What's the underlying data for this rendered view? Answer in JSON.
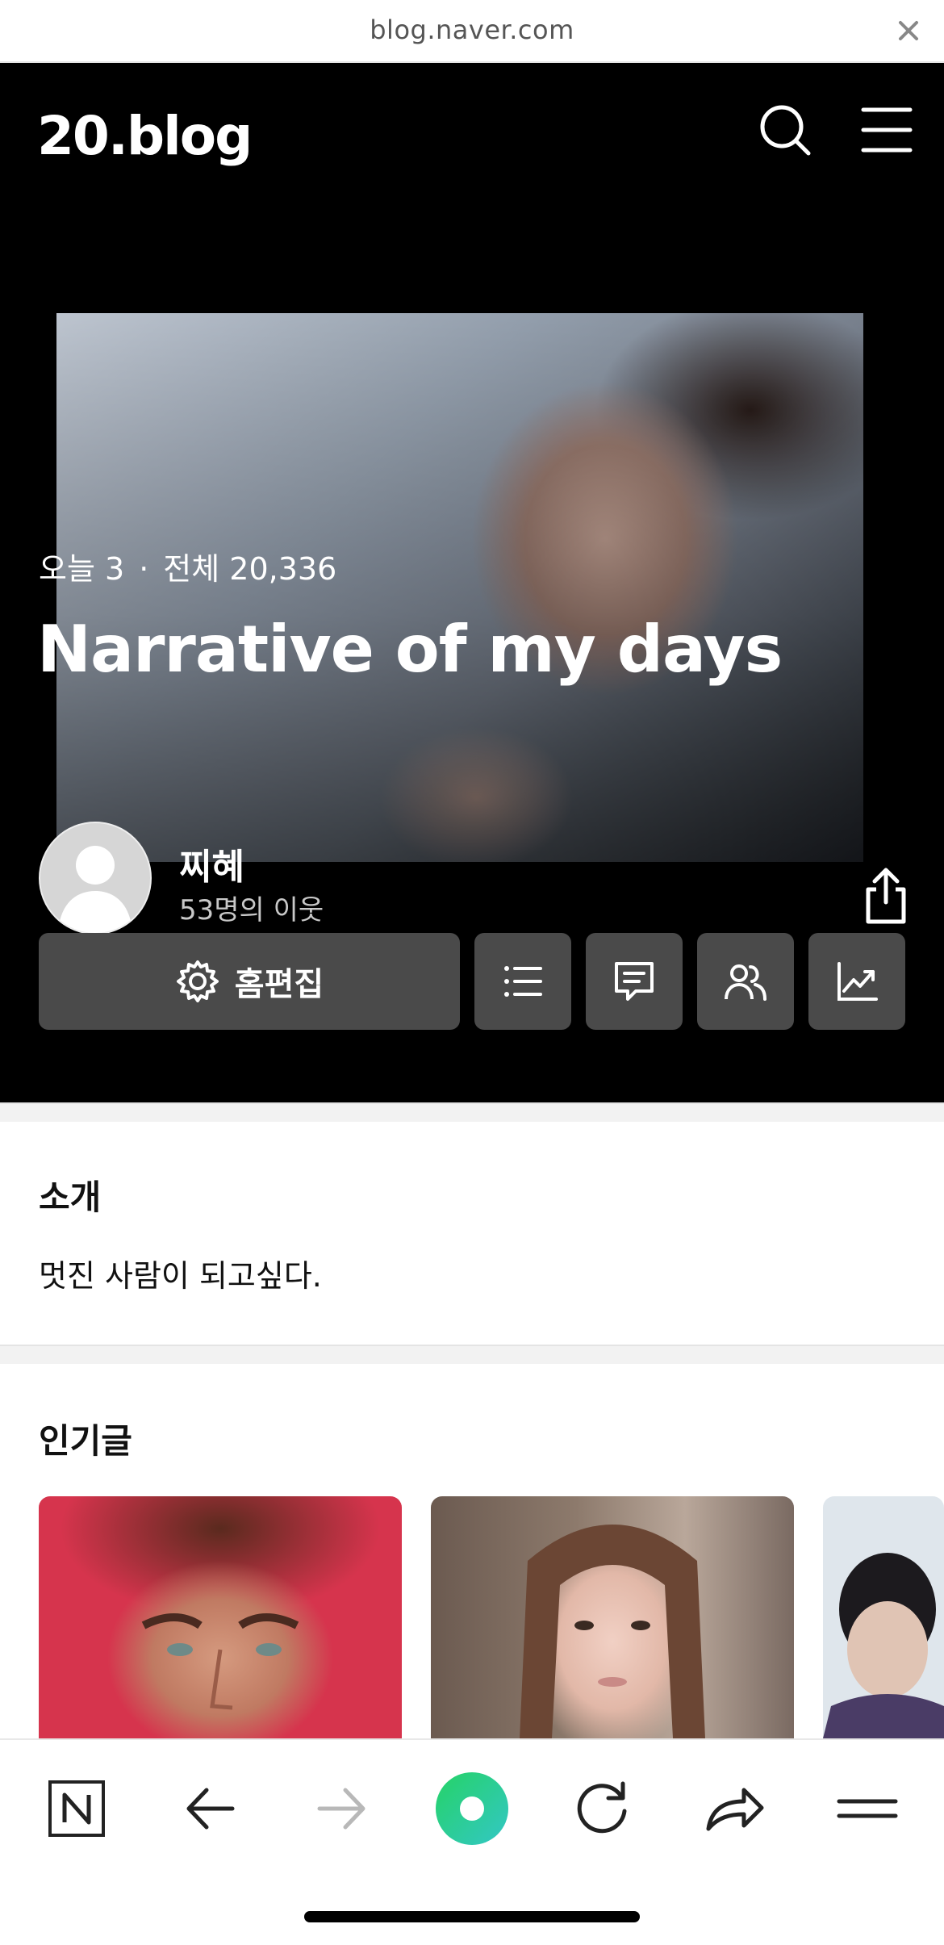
{
  "browser": {
    "url": "blog.naver.com",
    "close_icon": "close-icon"
  },
  "header": {
    "logo": "20.blog",
    "icons": [
      "search-icon",
      "menu-icon"
    ]
  },
  "profile": {
    "today_label": "오늘 3",
    "separator": "·",
    "total_label": "전체 20,336",
    "blog_title": "Narrative of my days",
    "user_name": "찌혜",
    "neighbors": "53명의 이웃",
    "share_icon": "share-icon"
  },
  "actions": {
    "edit_label": "홈편집",
    "icons": [
      "gear-icon",
      "list-icon",
      "comment-icon",
      "people-icon",
      "stats-chart-icon"
    ]
  },
  "intro": {
    "title": "소개",
    "text": "멋진 사람이 되고싶다."
  },
  "popular": {
    "title": "인기글",
    "cards": [
      "card-1",
      "card-2",
      "card-3"
    ]
  },
  "bottom_nav": {
    "icons": [
      "naver-n-icon",
      "back-arrow-icon",
      "forward-arrow-icon",
      "green-dot-icon",
      "refresh-icon",
      "share-arrow-icon",
      "menu-lines-icon"
    ]
  },
  "colors": {
    "hero_bg": "#000000",
    "button_bg": "#4a4a4a",
    "accent_green": "#1ec800"
  }
}
